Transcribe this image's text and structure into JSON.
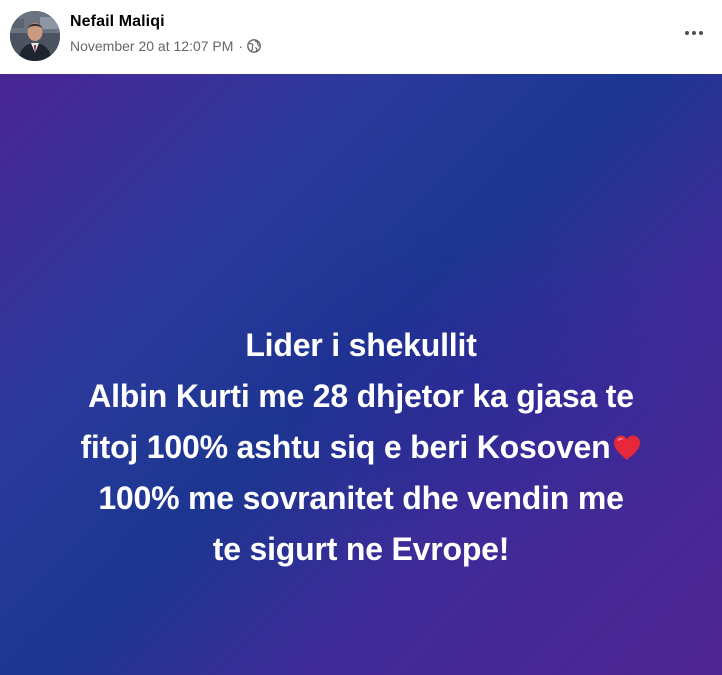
{
  "author": {
    "name": "Nefail Maliqi"
  },
  "post_meta": {
    "time": "November 20 at 12:07 PM",
    "separator": "·",
    "audience_icon": "globe-icon"
  },
  "menu": {
    "icon": "more-dots-icon"
  },
  "post": {
    "lines": [
      "Lider i shekullit",
      "Albin Kurti me 28 dhjetor ka gjasa te",
      "fitoj 100% ashtu siq e beri Kosoven",
      "100% me sovranitet dhe vendin me",
      "te sigurt ne Evrope!"
    ],
    "emoji": "heart-icon"
  },
  "colors": {
    "text_primary": "#050505",
    "text_secondary": "#65676b",
    "post_text": "#ffffff",
    "heart": "#e8283a",
    "background_purple": "#4a2594",
    "background_blue": "#1b3690"
  }
}
